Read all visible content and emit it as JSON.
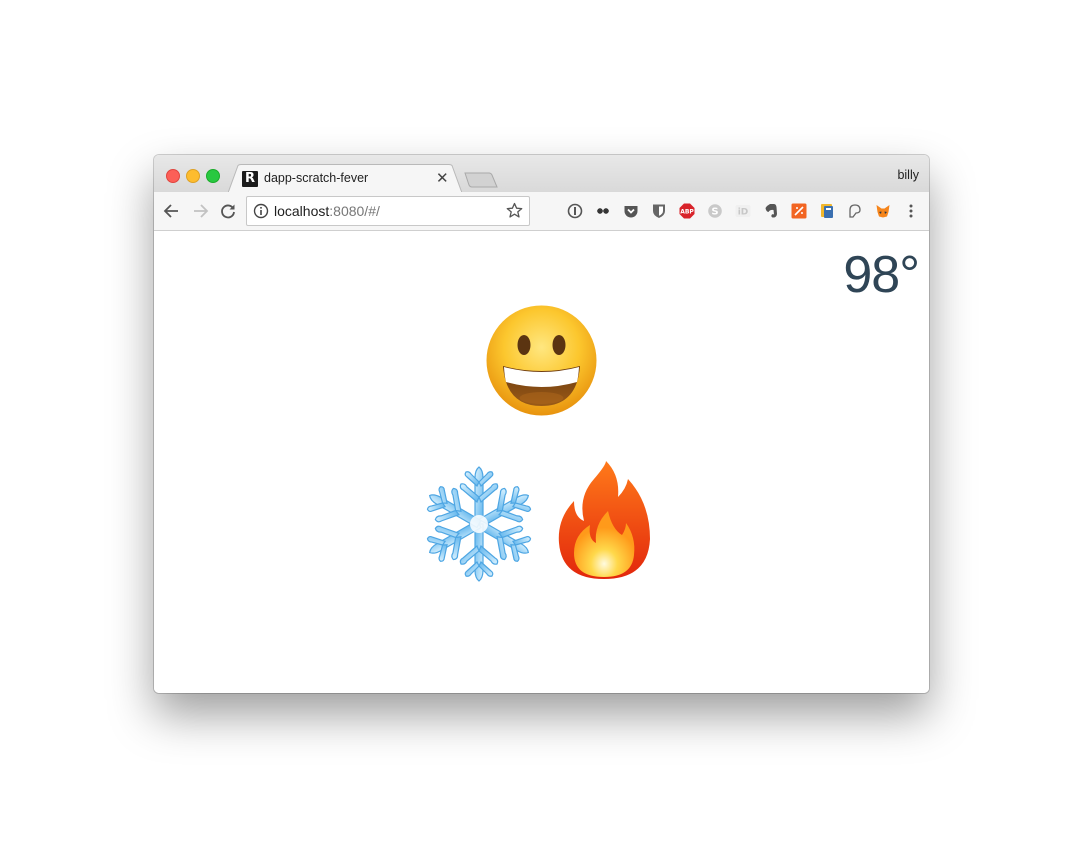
{
  "browser": {
    "tab_title": "dapp-scratch-fever",
    "tab_favicon_letter": "R",
    "profile_name": "billy",
    "url_host": "localhost",
    "url_rest": ":8080/#/"
  },
  "extensions": [
    "1password-icon",
    "plug-icon",
    "pocket-icon",
    "bitwarden-icon",
    "adblock-plus-icon",
    "skype-icon",
    "id-icon",
    "evernote-icon",
    "pdf-icon",
    "wallet-icon",
    "ghost-icon",
    "metamask-icon"
  ],
  "extension_labels": {
    "adblock": "ABP",
    "id": "iD"
  },
  "page": {
    "temperature": "98°",
    "mood_icon": "grinning-face-icon",
    "cold_icon": "snowflake-icon",
    "hot_icon": "fire-icon"
  },
  "colors": {
    "temperature_text": "#2f4556",
    "close": "#fc5f57",
    "minimize": "#fdbc2e",
    "maximize": "#28c840"
  }
}
